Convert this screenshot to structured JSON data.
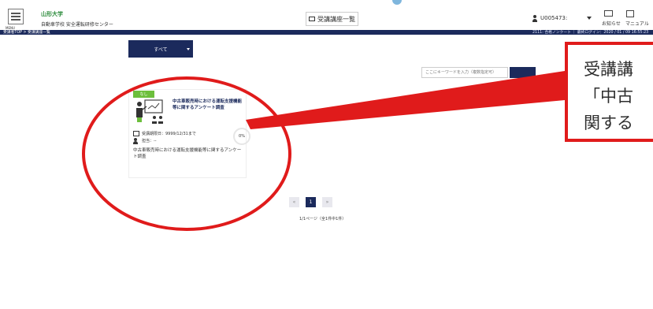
{
  "header": {
    "menu_label": "MENU",
    "logo_main": "山形大学",
    "logo_sub": "自動車学校 安全運転研修センター",
    "course_list_button": "受講講座一覧",
    "user_label": "U005473:",
    "notice_label": "お知らせ",
    "manual_label": "マニュアル",
    "breadcrumb": "受講者TOP > 受講講座一覧",
    "nav_right": "2111: 合格ノンクート ｜ 最終ログイン：2020 / 01 / 09 16:55:23"
  },
  "filter": {
    "selected": "すべて"
  },
  "search": {
    "placeholder": "ここにキーワードを入力（複数指定可）"
  },
  "course_card": {
    "badge": "なし",
    "title": "中古車販売時における運転支援機能等に関するアンケート調査",
    "period": "受講期限日：9999/12/31まで",
    "owner": "担当：--",
    "progress": "0%",
    "description": "中古車販売時における運転支援機能等に関するアンケート調査"
  },
  "pagination": {
    "prev": "«",
    "current": "1",
    "next": "»",
    "info": "1/1ページ（全1件中1件）"
  },
  "annotation": {
    "line1": "受講講",
    "line2": "「中古",
    "line3": "関する"
  },
  "colors": {
    "navy": "#1b2a5c",
    "badge_green": "#6cbf3c",
    "annotation_red": "#e01b1b"
  }
}
